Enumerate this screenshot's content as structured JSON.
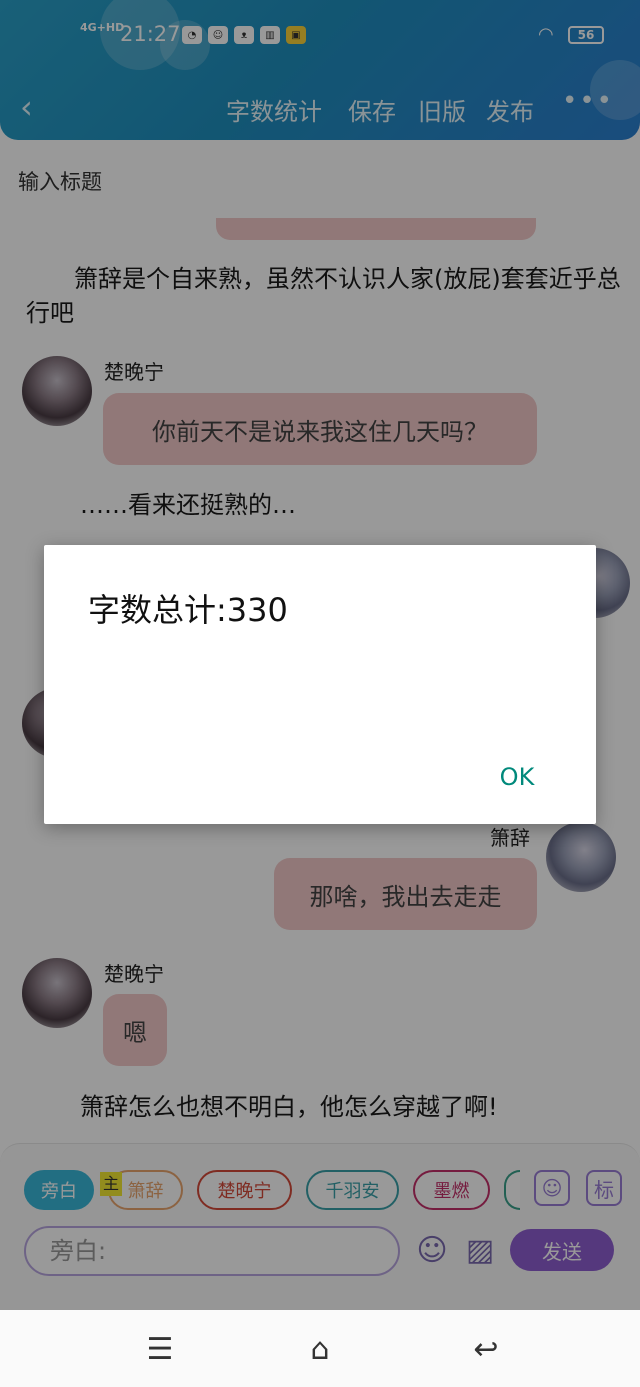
{
  "status_bar": {
    "signal": "4G+HD",
    "time": "21:27",
    "battery": "56",
    "app_icons": [
      "compass-icon",
      "face-icon",
      "cat-icon",
      "book-icon",
      "kuaikan-icon"
    ]
  },
  "toolbar": {
    "word_count_label": "字数统计",
    "save_label": "保存",
    "old_version_label": "旧版",
    "publish_label": "发布",
    "more_label": "•••"
  },
  "document": {
    "title_placeholder": "输入标题",
    "narration_1": "　　箫辞是个自来熟，虽然不认识人家(放屁)套套近乎总行吧",
    "speaker_1": "楚晚宁",
    "message_1": "你前天不是说来我这住几天吗？",
    "narration_2": "……看来还挺熟的…",
    "speaker_2": "箫辞",
    "message_2": "那啥，我出去走走",
    "speaker_3": "楚晚宁",
    "message_3": "嗯",
    "narration_3": "箫辞怎么也想不明白，他怎么穿越了啊!"
  },
  "dialog": {
    "message": "字数总计:330",
    "ok_label": "OK"
  },
  "input_panel": {
    "roles": [
      "旁白",
      "箫辞",
      "楚晚宁",
      "千羽安",
      "墨燃"
    ],
    "main_tag": "主",
    "tag_button": "标",
    "input_placeholder": "旁白:",
    "send_label": "发送"
  },
  "colors": {
    "header_accent": "#2aa0c8",
    "dialog_button": "#00897b",
    "send_button": "#8e5ed0",
    "chat_bubble": "#f2c9c9"
  }
}
